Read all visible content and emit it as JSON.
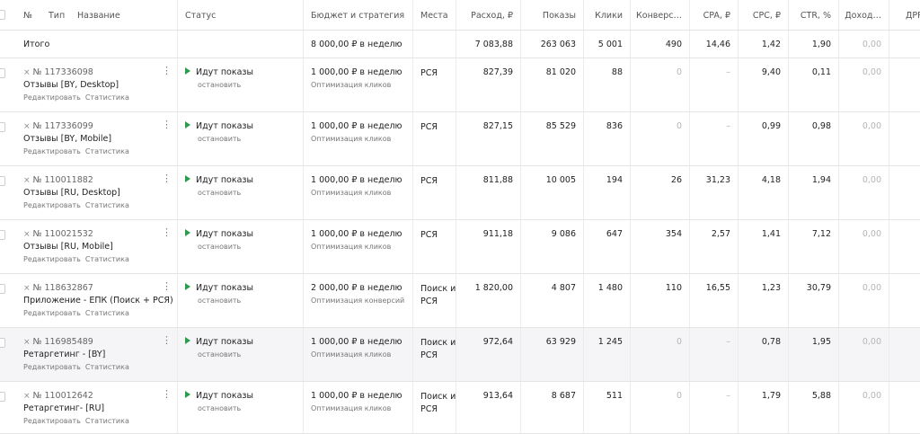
{
  "headers": {
    "num": "№",
    "type": "Тип",
    "name": "Название",
    "status": "Статус",
    "budget": "Бюджет и стратегия",
    "places": "Места",
    "spend": "Расход, ₽",
    "impressions": "Показы",
    "clicks": "Клики",
    "conversions": "Конверс…",
    "cpa": "CPA, ₽",
    "cpc": "CPC, ₽",
    "ctr": "CTR, %",
    "income": "Доход…",
    "drr": "ДРР"
  },
  "total": {
    "label": "Итого",
    "budget": "8 000,00 ₽ в неделю",
    "spend": "7 083,88",
    "impressions": "263 063",
    "clicks": "5 001",
    "conversions": "490",
    "cpa": "14,46",
    "cpc": "1,42",
    "ctr": "1,90",
    "income": "0,00"
  },
  "common": {
    "edit_link": "Редактировать",
    "stats_link": "Статистика",
    "status": "Идут показы",
    "status_action": "остановить",
    "kebab": "⋮",
    "id_mark": "⨯"
  },
  "rows": [
    {
      "id": "№ 117336098",
      "name": "Отзывы [BY, Desktop]",
      "budget": "1 000,00 ₽ в неделю",
      "strategy": "Оптимизация кликов",
      "places": "РСЯ",
      "spend": "827,39",
      "impressions": "81 020",
      "clicks": "88",
      "conversions": "0",
      "cpa": "–",
      "cpc": "9,40",
      "ctr": "0,11",
      "income": "0,00",
      "muted_conv": true
    },
    {
      "id": "№ 117336099",
      "name": "Отзывы [BY, Mobile]",
      "budget": "1 000,00 ₽ в неделю",
      "strategy": "Оптимизация кликов",
      "places": "РСЯ",
      "spend": "827,15",
      "impressions": "85 529",
      "clicks": "836",
      "conversions": "0",
      "cpa": "–",
      "cpc": "0,99",
      "ctr": "0,98",
      "income": "0,00",
      "muted_conv": true
    },
    {
      "id": "№ 110011882",
      "name": "Отзывы [RU, Desktop]",
      "budget": "1 000,00 ₽ в неделю",
      "strategy": "Оптимизация кликов",
      "places": "РСЯ",
      "spend": "811,88",
      "impressions": "10 005",
      "clicks": "194",
      "conversions": "26",
      "cpa": "31,23",
      "cpc": "4,18",
      "ctr": "1,94",
      "income": "0,00",
      "muted_conv": false
    },
    {
      "id": "№ 110021532",
      "name": "Отзывы [RU, Mobile]",
      "budget": "1 000,00 ₽ в неделю",
      "strategy": "Оптимизация кликов",
      "places": "РСЯ",
      "spend": "911,18",
      "impressions": "9 086",
      "clicks": "647",
      "conversions": "354",
      "cpa": "2,57",
      "cpc": "1,41",
      "ctr": "7,12",
      "income": "0,00",
      "muted_conv": false
    },
    {
      "id": "№ 118632867",
      "name": "Приложение - ЕПК (Поиск + РСЯ)",
      "budget": "2 000,00 ₽ в неделю",
      "strategy": "Оптимизация конверсий",
      "places": "Поиск и РСЯ",
      "spend": "1 820,00",
      "impressions": "4 807",
      "clicks": "1 480",
      "conversions": "110",
      "cpa": "16,55",
      "cpc": "1,23",
      "ctr": "30,79",
      "income": "0,00",
      "muted_conv": false
    },
    {
      "id": "№ 116985489",
      "name": "Ретаргетинг - [BY]",
      "budget": "1 000,00 ₽ в неделю",
      "strategy": "Оптимизация кликов",
      "places": "Поиск и РСЯ",
      "spend": "972,64",
      "impressions": "63 929",
      "clicks": "1 245",
      "conversions": "0",
      "cpa": "–",
      "cpc": "0,78",
      "ctr": "1,95",
      "income": "0,00",
      "muted_conv": true
    },
    {
      "id": "№ 110012642",
      "name": "Ретаргетинг- [RU]",
      "budget": "1 000,00 ₽ в неделю",
      "strategy": "Оптимизация кликов",
      "places": "Поиск и РСЯ",
      "spend": "913,64",
      "impressions": "8 687",
      "clicks": "511",
      "conversions": "0",
      "cpa": "–",
      "cpc": "1,79",
      "ctr": "5,88",
      "income": "0,00",
      "muted_conv": true
    }
  ]
}
